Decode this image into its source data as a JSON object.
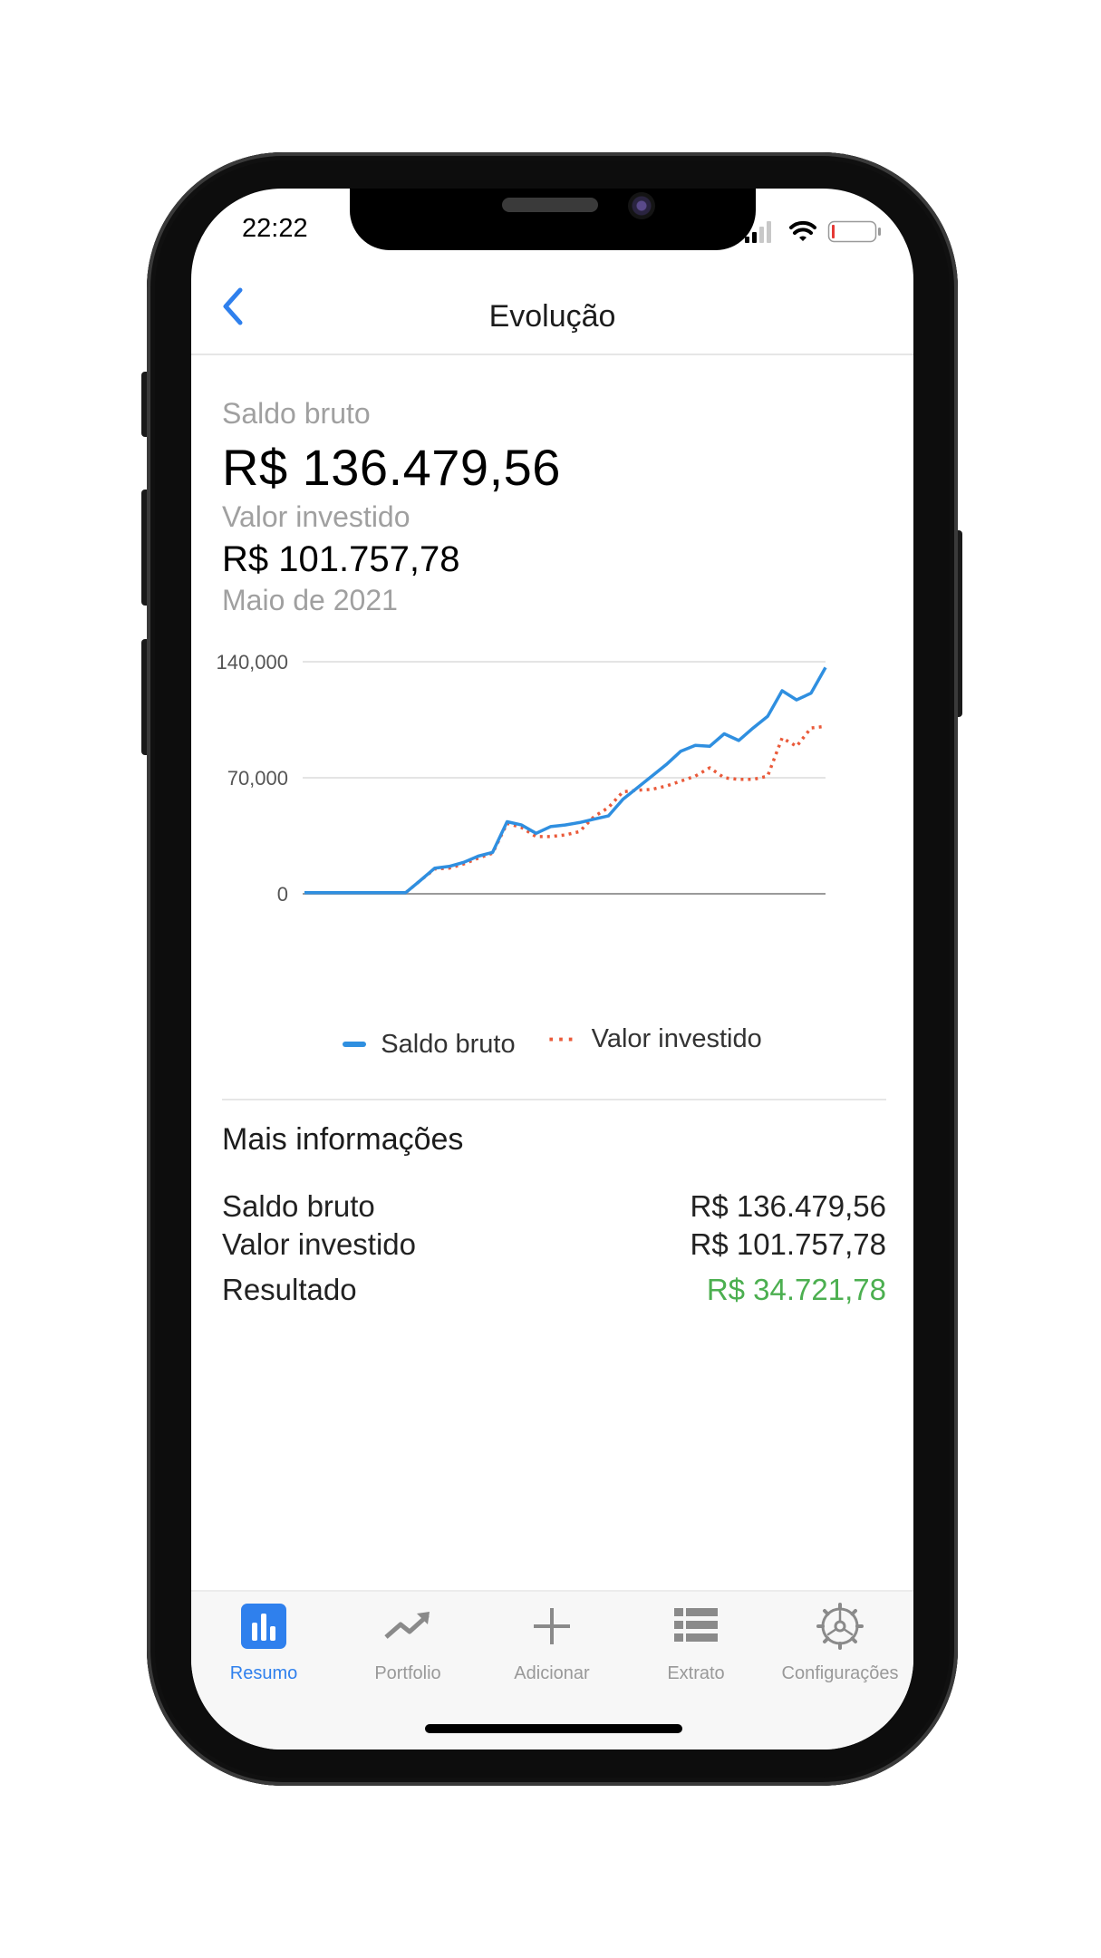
{
  "status": {
    "time": "22:22"
  },
  "nav": {
    "title": "Evolução",
    "back_icon": "chevron-left-icon"
  },
  "summary": {
    "gross_label": "Saldo bruto",
    "gross_value": "R$ 136.479,56",
    "invested_label": "Valor investido",
    "invested_value": "R$ 101.757,78",
    "period": "Maio de 2021"
  },
  "chart_data": {
    "type": "line",
    "ylim": [
      0,
      140000
    ],
    "yticks": [
      "140,000",
      "70,000",
      "0"
    ],
    "grid": true,
    "legend_position": "bottom",
    "series": [
      {
        "name": "Saldo bruto",
        "color": "#2f8fe0",
        "style": "solid",
        "values": [
          700,
          700,
          700,
          700,
          700,
          700,
          700,
          700,
          8000,
          15500,
          16500,
          19000,
          22700,
          25000,
          43500,
          41500,
          36500,
          40500,
          41500,
          43000,
          45000,
          47000,
          57000,
          64000,
          71000,
          78000,
          86000,
          89500,
          89000,
          96500,
          92500,
          100000,
          107000,
          122500,
          117000,
          121000,
          136500
        ]
      },
      {
        "name": "Valor investido",
        "color": "#ea5a3a",
        "style": "dotted",
        "values": [
          700,
          700,
          700,
          700,
          700,
          700,
          700,
          700,
          8000,
          15000,
          15500,
          18000,
          21500,
          24500,
          42500,
          40000,
          34500,
          34500,
          35500,
          37500,
          46500,
          52000,
          61500,
          62500,
          63000,
          65000,
          68000,
          71000,
          76000,
          70000,
          69000,
          69000,
          71000,
          94000,
          89000,
          100000,
          101000
        ]
      }
    ]
  },
  "more_info": {
    "title": "Mais informações",
    "rows": [
      {
        "label": "Saldo bruto",
        "value": "R$ 136.479,56"
      },
      {
        "label": "Valor investido",
        "value": "R$ 101.757,78"
      },
      {
        "label": "Resultado",
        "value": "R$ 34.721,78"
      }
    ],
    "positive_color": "#4caf50"
  },
  "tabs": [
    {
      "label": "Resumo",
      "icon": "bar-chart-icon",
      "active": true
    },
    {
      "label": "Portfolio",
      "icon": "trend-up-icon",
      "active": false
    },
    {
      "label": "Adicionar",
      "icon": "plus-icon",
      "active": false
    },
    {
      "label": "Extrato",
      "icon": "list-icon",
      "active": false
    },
    {
      "label": "Configurações",
      "icon": "gear-icon",
      "active": false
    }
  ],
  "colors": {
    "accent": "#2f80ed",
    "muted": "#a0a0a0"
  }
}
